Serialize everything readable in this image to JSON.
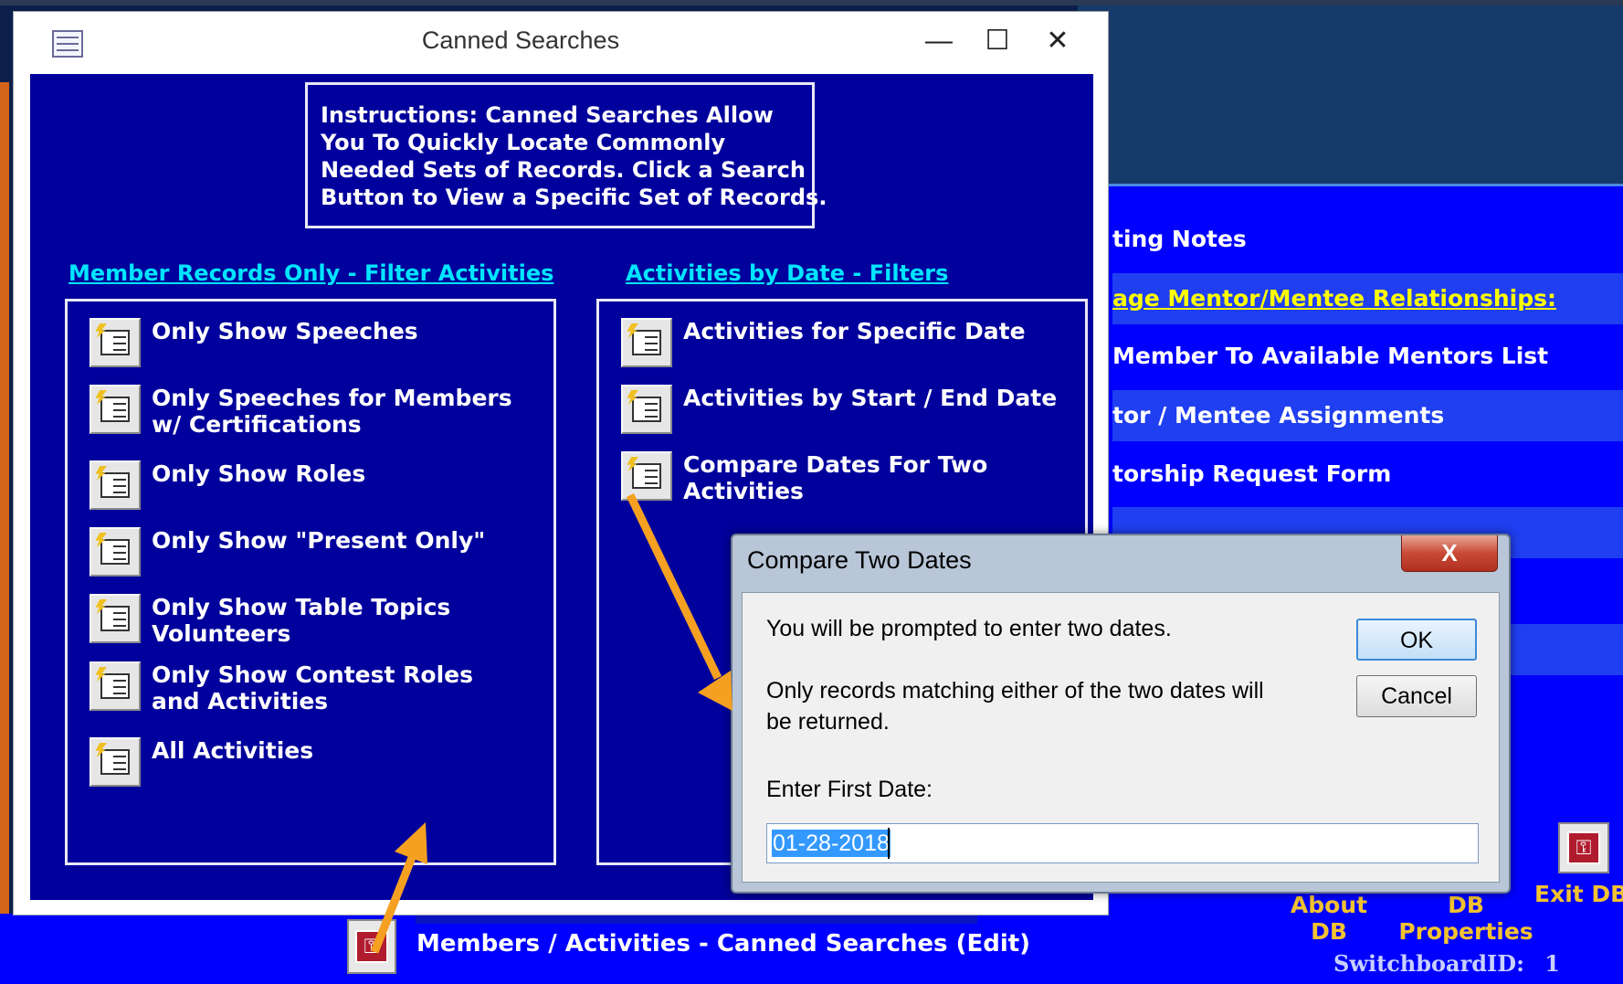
{
  "background": {
    "switchboard_items": [
      {
        "label": "ting Notes"
      },
      {
        "label": "age Mentor/Mentee Relationships:"
      },
      {
        "label": "Member To Available Mentors List"
      },
      {
        "label": "tor / Mentee Assignments"
      },
      {
        "label": "torship Request Form"
      }
    ],
    "about_db_label": "About\nDB",
    "db_properties_label": "DB\nProperties",
    "exit_db_label": "Exit DB",
    "switchboard_id_label": "SwitchboardID:",
    "switchboard_id_value": "1",
    "canned_searches_edit_label": "Members / Activities - Canned Searches (Edit)"
  },
  "window": {
    "title": "Canned Searches",
    "minimize_glyph": "—",
    "maximize_glyph": "☐",
    "close_glyph": "✕"
  },
  "instructions": {
    "lines": [
      "Instructions:  Canned Searches Allow",
      "You To Quickly Locate Commonly",
      "Needed Sets of Records.  Click a Search",
      "Button to View a Specific Set of Records."
    ]
  },
  "member_section": {
    "header": "Member Records Only - Filter Activities",
    "buttons": [
      {
        "line1": "Only Show Speeches",
        "line2": ""
      },
      {
        "line1": "Only Speeches for Members",
        "line2": "w/ Certifications"
      },
      {
        "line1": "Only Show Roles",
        "line2": ""
      },
      {
        "line1": "Only Show \"Present Only\"",
        "line2": ""
      },
      {
        "line1": "Only Show Table Topics",
        "line2": "Volunteers"
      },
      {
        "line1": "Only Show Contest Roles",
        "line2": "and Activities"
      },
      {
        "line1": "All Activities",
        "line2": ""
      }
    ]
  },
  "date_section": {
    "header": "Activities by Date - Filters",
    "buttons": [
      {
        "line1": "Activities for Specific Date",
        "line2": ""
      },
      {
        "line1": "Activities by Start / End Date",
        "line2": ""
      },
      {
        "line1": "Compare Dates For Two",
        "line2": "Activities"
      }
    ]
  },
  "dialog": {
    "title": "Compare Two Dates",
    "close_glyph": "X",
    "message1": "You will be prompted to enter two dates.",
    "message2_line1": "Only records matching either of the two dates will",
    "message2_line2": "be returned.",
    "field_label": "Enter First Date:",
    "field_value": "01-28-2018",
    "ok_label": "OK",
    "cancel_label": "Cancel"
  },
  "colors": {
    "form_background": "#00009c",
    "switchboard_background": "#0000ff",
    "link_cyan": "#00e5ff",
    "switchboard_header_yellow": "#ffff00",
    "arrow_orange": "#f5a020"
  },
  "icons": {
    "search_button": "form-lightning-icon",
    "edit_button": "key-form-icon",
    "window_app": "form-icon"
  }
}
